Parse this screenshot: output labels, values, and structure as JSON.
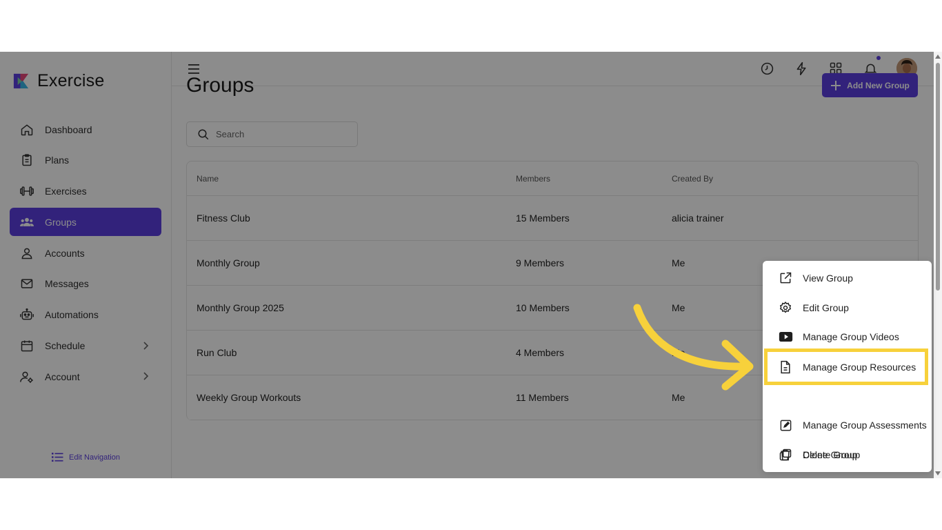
{
  "app": {
    "name": "Exercise"
  },
  "sidebar": {
    "items": [
      {
        "label": "Dashboard",
        "icon": "home-icon"
      },
      {
        "label": "Plans",
        "icon": "clipboard-icon"
      },
      {
        "label": "Exercises",
        "icon": "dumbbell-icon"
      },
      {
        "label": "Groups",
        "icon": "users-icon",
        "active": true
      },
      {
        "label": "Accounts",
        "icon": "user-icon"
      },
      {
        "label": "Messages",
        "icon": "mail-icon"
      },
      {
        "label": "Automations",
        "icon": "robot-icon"
      },
      {
        "label": "Schedule",
        "icon": "calendar-icon",
        "has_submenu": true
      },
      {
        "label": "Account",
        "icon": "user-gear-icon",
        "has_submenu": true
      }
    ],
    "edit_nav_label": "Edit Navigation"
  },
  "topbar": {
    "icons": [
      "clock-icon",
      "lightning-icon",
      "grid-icon",
      "bell-icon",
      "avatar"
    ],
    "has_notification": true
  },
  "page": {
    "title": "Groups",
    "add_button_label": "Add New Group",
    "search_placeholder": "Search"
  },
  "table": {
    "headers": {
      "name": "Name",
      "members": "Members",
      "created_by": "Created By"
    },
    "rows": [
      {
        "name": "Fitness Club",
        "members": "15 Members",
        "created_by": "alicia trainer"
      },
      {
        "name": "Monthly Group",
        "members": "9 Members",
        "created_by": "Me"
      },
      {
        "name": "Monthly Group 2025",
        "members": "10 Members",
        "created_by": "Me"
      },
      {
        "name": "Run Club",
        "members": "4 Members",
        "created_by": "Me"
      },
      {
        "name": "Weekly Group Workouts",
        "members": "11 Members",
        "created_by": "Me"
      }
    ]
  },
  "menu": {
    "items": [
      {
        "label": "View Group",
        "icon": "external-link-icon"
      },
      {
        "label": "Edit Group",
        "icon": "gear-icon"
      },
      {
        "label": "Manage Group Videos",
        "icon": "video-icon"
      },
      {
        "label": "Manage Group Resources",
        "icon": "document-icon",
        "highlighted": true
      },
      {
        "label": "Manage Group Assessments",
        "icon": "edit-square-icon"
      },
      {
        "label": "Clone Group",
        "icon": "copy-icon"
      },
      {
        "label": "Delete Group",
        "icon": "trash-icon"
      }
    ]
  },
  "colors": {
    "accent": "#5b3fe0",
    "highlight": "#f7d13b"
  }
}
